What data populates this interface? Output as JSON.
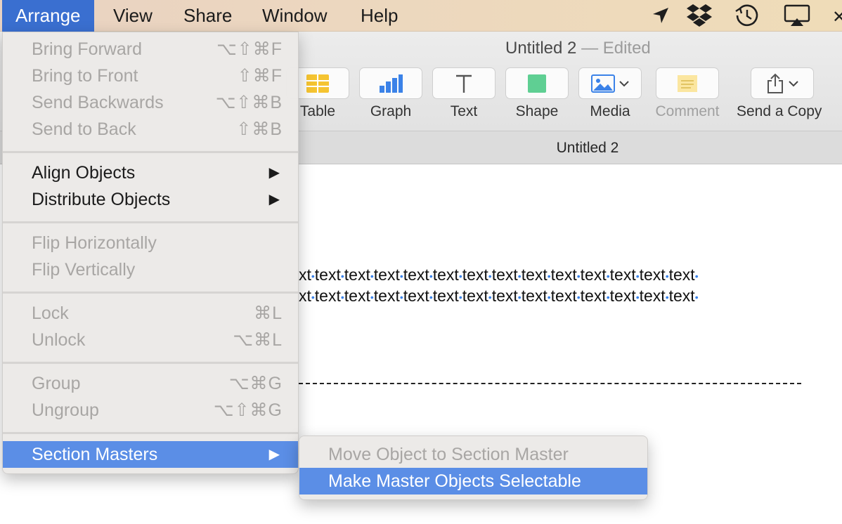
{
  "menubar": {
    "items": [
      "Arrange",
      "View",
      "Share",
      "Window",
      "Help"
    ],
    "active": "Arrange",
    "status_icons": [
      "location-arrow-icon",
      "dropbox-icon",
      "time-machine-icon",
      "airplay-icon"
    ]
  },
  "window": {
    "title": "Untitled 2",
    "title_suffix": "— Edited",
    "tab_title": "Untitled 2"
  },
  "toolbar": {
    "items": [
      {
        "label": "Table",
        "icon": "table-icon"
      },
      {
        "label": "Graph",
        "icon": "graph-icon"
      },
      {
        "label": "Text",
        "icon": "text-icon"
      },
      {
        "label": "Shape",
        "icon": "shape-icon"
      },
      {
        "label": "Media",
        "icon": "media-icon"
      },
      {
        "label": "Comment",
        "icon": "comment-icon",
        "disabled": true
      },
      {
        "label": "Send a Copy",
        "icon": "share-icon"
      }
    ]
  },
  "document": {
    "line1": "xt•text•text•text•text•text•text•text•text•text•text•text•text•text•",
    "line2": "xt•text•text•text•text•text•text•text•text•text•text•text•text•text•"
  },
  "arrange_menu": {
    "bring_forward": {
      "label": "Bring Forward",
      "shortcut": "⌥⇧⌘F"
    },
    "bring_to_front": {
      "label": "Bring to Front",
      "shortcut": "⇧⌘F"
    },
    "send_backwards": {
      "label": "Send Backwards",
      "shortcut": "⌥⇧⌘B"
    },
    "send_to_back": {
      "label": "Send to Back",
      "shortcut": "⇧⌘B"
    },
    "align_objects": {
      "label": "Align Objects"
    },
    "distribute_objects": {
      "label": "Distribute Objects"
    },
    "flip_horizontally": {
      "label": "Flip Horizontally"
    },
    "flip_vertically": {
      "label": "Flip Vertically"
    },
    "lock": {
      "label": "Lock",
      "shortcut": "⌘L"
    },
    "unlock": {
      "label": "Unlock",
      "shortcut": "⌥⌘L"
    },
    "group": {
      "label": "Group",
      "shortcut": "⌥⌘G"
    },
    "ungroup": {
      "label": "Ungroup",
      "shortcut": "⌥⇧⌘G"
    },
    "section_masters": {
      "label": "Section Masters"
    }
  },
  "section_masters_submenu": {
    "move_object": {
      "label": "Move Object to Section Master"
    },
    "make_selectable": {
      "label": "Make Master Objects Selectable"
    }
  },
  "colors": {
    "menu_highlight": "#5b8ee6",
    "active_menu_title": "#3a6fd0",
    "disabled_text": "#a8a6a4"
  }
}
